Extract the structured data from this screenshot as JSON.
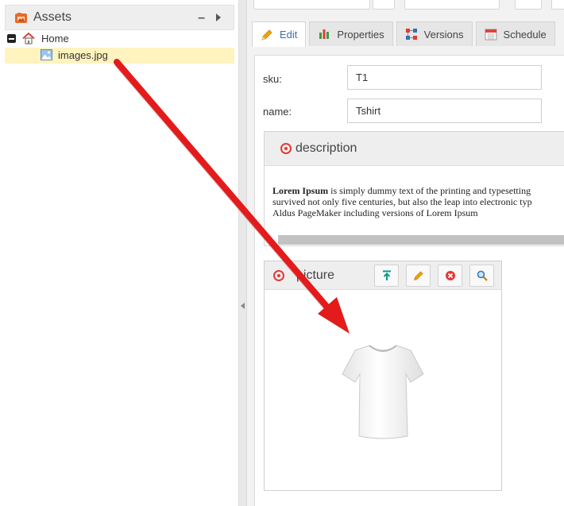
{
  "assets_panel": {
    "title": "Assets",
    "tree": {
      "home_label": "Home",
      "file_label": "images.jpg"
    }
  },
  "tabs": [
    {
      "label": "Edit",
      "icon": "pencil-icon",
      "active": true
    },
    {
      "label": "Properties",
      "icon": "properties-icon",
      "active": false
    },
    {
      "label": "Versions",
      "icon": "versions-icon",
      "active": false
    },
    {
      "label": "Schedule",
      "icon": "calendar-icon",
      "active": false
    }
  ],
  "form": {
    "sku_label": "sku:",
    "sku_value": "T1",
    "name_label": "name:",
    "name_value": "Tshirt",
    "description": {
      "title": "description",
      "text_bold": "Lorem Ipsum",
      "text_line1_rest": " is simply dummy text of the printing and typesetting",
      "text_line2": "survived not only five centuries, but also the leap into electronic typ",
      "text_line3": "Aldus PageMaker including versions of Lorem Ipsum"
    },
    "picture": {
      "title": "picture",
      "buttons": [
        "upload-icon",
        "edit-icon",
        "clear-icon",
        "zoom-icon"
      ]
    }
  },
  "colors": {
    "accent_blue": "#3a6fb0",
    "selected_row": "#fff4bf",
    "target_red": "#e53935",
    "annotation_arrow": "#e31b1b"
  }
}
